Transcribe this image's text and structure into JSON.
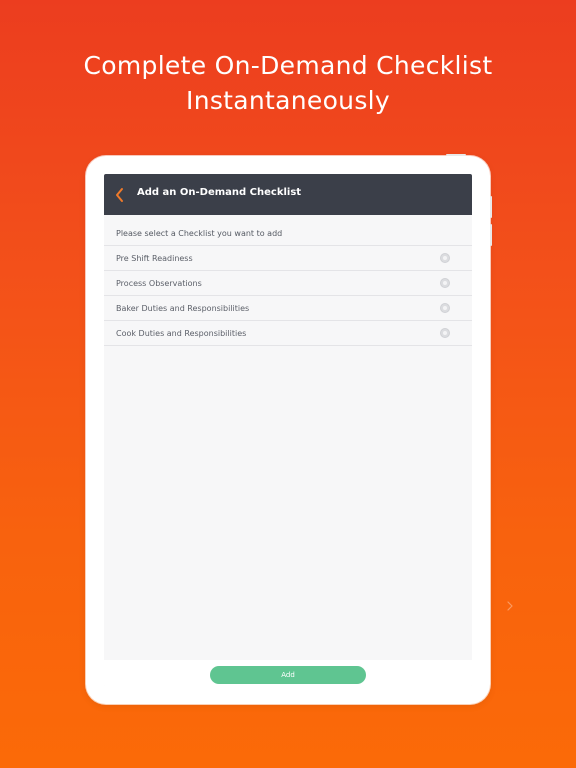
{
  "promo": {
    "headline_line1": "Complete On-Demand Checklist",
    "headline_line2": "Instantaneously"
  },
  "navbar": {
    "title": "Add an On-Demand Checklist",
    "back_icon": "chevron-left-icon"
  },
  "content": {
    "prompt": "Please select a Checklist you want to add",
    "items": [
      {
        "label": "Pre Shift Readiness",
        "selected": false
      },
      {
        "label": "Process Observations",
        "selected": false
      },
      {
        "label": "Baker Duties and Responsibilities",
        "selected": false
      },
      {
        "label": "Cook Duties and Responsibilities",
        "selected": false
      }
    ]
  },
  "footer": {
    "add_label": "Add"
  },
  "colors": {
    "background_top": "#ec3d1f",
    "background_bottom": "#fb6a08",
    "navbar": "#3b3f49",
    "accent_back": "#f07a2a",
    "add_button": "#5fc591"
  }
}
